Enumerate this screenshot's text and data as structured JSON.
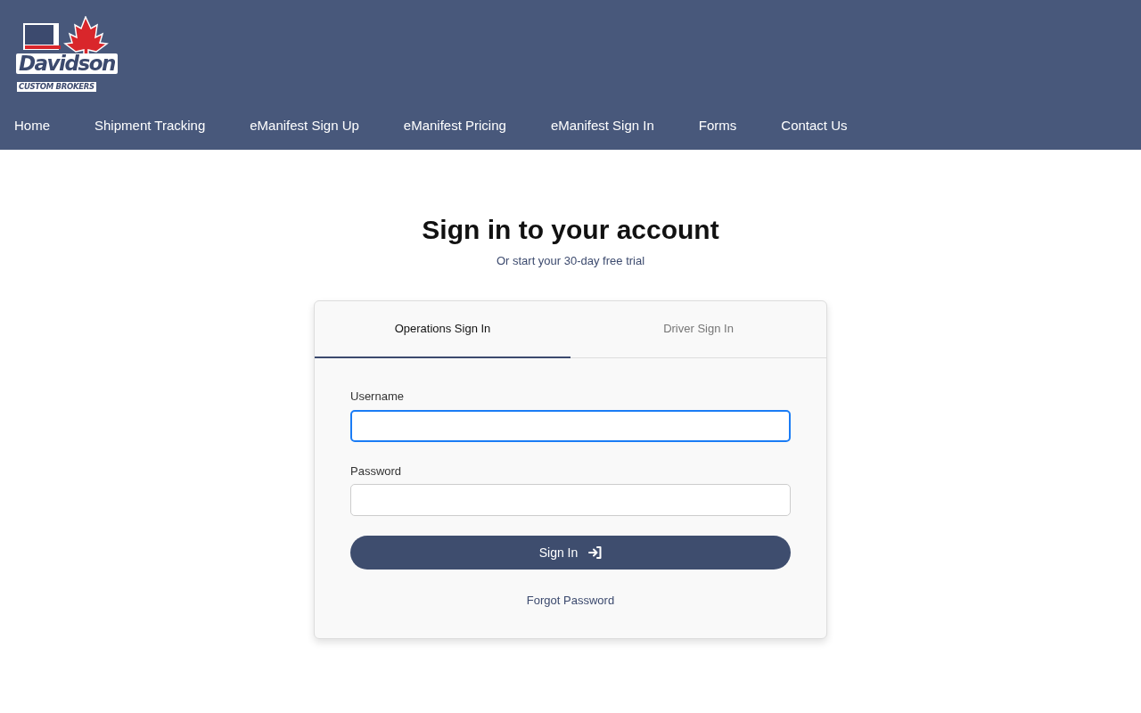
{
  "logo": {
    "name": "Davidson",
    "tagline": "CUSTOM BROKERS"
  },
  "nav": [
    {
      "label": "Home"
    },
    {
      "label": "Shipment Tracking"
    },
    {
      "label": "eManifest Sign Up"
    },
    {
      "label": "eManifest Pricing"
    },
    {
      "label": "eManifest Sign In"
    },
    {
      "label": "Forms"
    },
    {
      "label": "Contact Us"
    }
  ],
  "heading": "Sign in to your account",
  "subheading": "Or start your 30-day free trial",
  "tabs": [
    {
      "label": "Operations Sign In",
      "selected": true
    },
    {
      "label": "Driver Sign In",
      "selected": false
    }
  ],
  "fields": [
    {
      "label": "Username",
      "focused": true
    },
    {
      "label": "Password",
      "focused": false
    }
  ],
  "submit": {
    "label": "Sign In"
  },
  "forgot_link": "Forgot Password"
}
